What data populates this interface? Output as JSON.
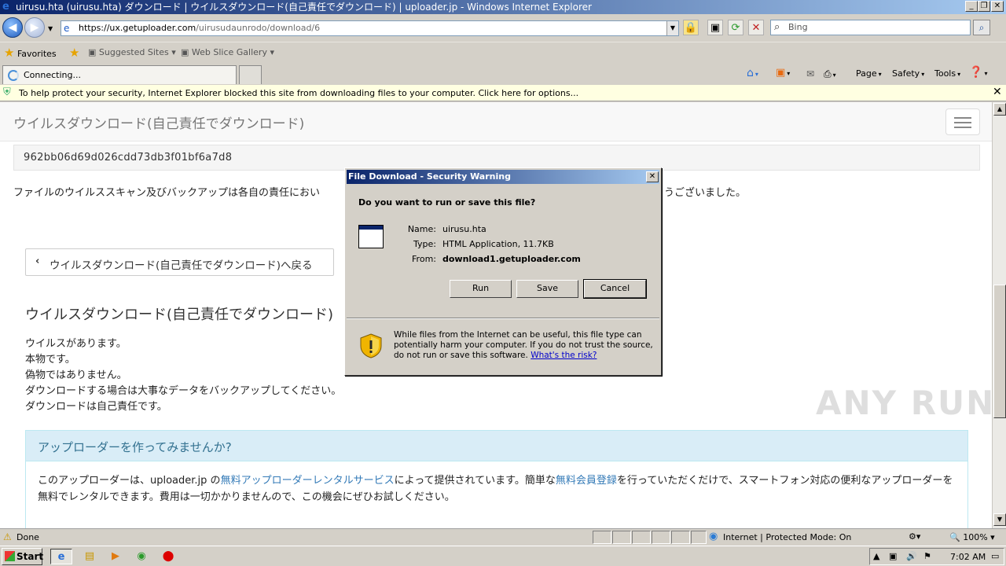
{
  "window": {
    "title": "uirusu.hta (uirusu.hta) ダウンロード | ウイルスダウンロード(自己責任でダウンロード) | uploader.jp - Windows Internet Explorer"
  },
  "address_bar": {
    "url_host": "https://ux.getuploader.com",
    "url_path": "/uirusudaunrodo/download/6",
    "search_placeholder": "Bing"
  },
  "favorites_bar": {
    "favorites_label": "Favorites",
    "items": [
      "Suggested Sites",
      "Web Slice Gallery"
    ]
  },
  "tabs": [
    {
      "label": "Connecting..."
    }
  ],
  "command_bar": {
    "page": "Page",
    "safety": "Safety",
    "tools": "Tools"
  },
  "info_bar": {
    "message": "To help protect your security, Internet Explorer blocked this site from downloading files to your computer. Click here for options..."
  },
  "site": {
    "brand": "ウイルスダウンロード(自己責任でダウンロード)",
    "hash": "962bb06d69d026cdd73db3f01bf6a7d8",
    "notice_start": "ファイルのウイルススキャン及びバックアップは各自の責任におい",
    "notice_end": "うございました。",
    "back_button": "ウイルスダウンロード(自己責任でダウンロード)へ戻る",
    "heading": "ウイルスダウンロード(自己責任でダウンロード)",
    "description": [
      "ウイルスがあります。",
      "本物です。",
      "偽物ではありません。",
      "ダウンロードする場合は大事なデータをバックアップしてください。",
      "ダウンロードは自己責任です。"
    ],
    "panel": {
      "title": "アップローダーを作ってみませんか?",
      "body_1": "このアップローダーは、uploader.jp の",
      "link_1": "無料アップローダーレンタルサービス",
      "body_2": "によって提供されています。簡単な",
      "link_2": "無料会員登録",
      "body_3": "を行っていただくだけで、スマートフォン対応の便利なアップローダーを無料でレンタルできます。費用は一切かかりませんので、この機会にぜひお試しください。"
    }
  },
  "watermark": "ANY RUN",
  "dialog": {
    "title": "File Download - Security Warning",
    "question": "Do you want to run or save this file?",
    "name_label": "Name:",
    "name_value": "uirusu.hta",
    "type_label": "Type:",
    "type_value": "HTML Application, 11.7KB",
    "from_label": "From:",
    "from_value": "download1.getuploader.com",
    "run": "Run",
    "save": "Save",
    "cancel": "Cancel",
    "warning": "While files from the Internet can be useful, this file type can potentially harm your computer. If you do not trust the source, do not run or save this software.",
    "risk_link": "What's the risk?"
  },
  "status_bar": {
    "status": "Done",
    "zone": "Internet | Protected Mode: On",
    "zoom": "100%"
  },
  "taskbar": {
    "start": "Start",
    "clock": "7:02 AM"
  },
  "colors": {
    "titlebar": "#0a246a",
    "infobar": "#ffffe1",
    "panel_head": "#d9edf7",
    "link": "#337ab7"
  }
}
